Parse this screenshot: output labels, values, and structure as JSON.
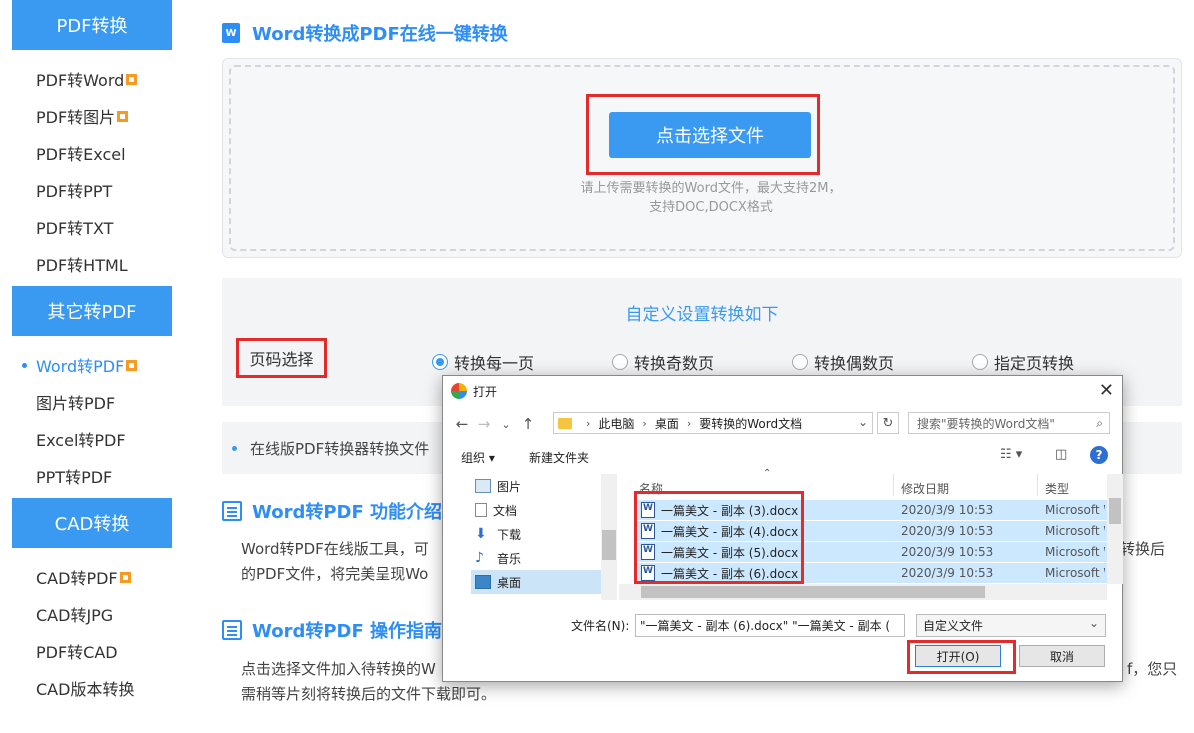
{
  "sidebar": {
    "sections": [
      {
        "title": "PDF转换",
        "items": [
          {
            "label": "PDF转Word",
            "badge": true
          },
          {
            "label": "PDF转图片",
            "badge": true
          },
          {
            "label": "PDF转Excel",
            "badge": false
          },
          {
            "label": "PDF转PPT",
            "badge": false
          },
          {
            "label": "PDF转TXT",
            "badge": false
          },
          {
            "label": "PDF转HTML",
            "badge": false
          }
        ]
      },
      {
        "title": "其它转PDF",
        "items": [
          {
            "label": "Word转PDF",
            "badge": true,
            "active": true
          },
          {
            "label": "图片转PDF",
            "badge": false
          },
          {
            "label": "Excel转PDF",
            "badge": false
          },
          {
            "label": "PPT转PDF",
            "badge": false
          }
        ]
      },
      {
        "title": "CAD转换",
        "items": [
          {
            "label": "CAD转PDF",
            "badge": true
          },
          {
            "label": "CAD转JPG",
            "badge": false
          },
          {
            "label": "PDF转CAD",
            "badge": false
          },
          {
            "label": "CAD版本转换",
            "badge": false
          }
        ]
      }
    ]
  },
  "main": {
    "title": "Word转换成PDF在线一键转换",
    "upload": {
      "button": "点击选择文件",
      "hint_line1": "请上传需要转换的Word文件，最大支持2M，",
      "hint_line2": "支持DOC,DOCX格式"
    },
    "settings": {
      "title": "自定义设置转换如下",
      "page_label": "页码选择",
      "options": [
        "转换每一页",
        "转换奇数页",
        "转换偶数页",
        "指定页转换"
      ],
      "selected": "转换每一页"
    },
    "note": "在线版PDF转换器转换文件",
    "intro": {
      "title": "Word转PDF 功能介绍：",
      "line1_left": "Word转PDF在线版工具，可",
      "line1_right": "转换后",
      "line2": "的PDF文件，将完美呈现Wo"
    },
    "guide": {
      "title": "Word转PDF 操作指南：",
      "line1_left": "点击选择文件加入待转换的W",
      "line1_right": "f，您只",
      "line2": "需稍等片刻将转换后的文件下载即可。"
    }
  },
  "dialog": {
    "title": "打开",
    "breadcrumb": [
      "此电脑",
      "桌面",
      "要转换的Word文档"
    ],
    "search_placeholder": "搜索\"要转换的Word文档\"",
    "toolbar": {
      "organize": "组织 ▾",
      "new_folder": "新建文件夹"
    },
    "tree": [
      "图片",
      "文档",
      "下载",
      "音乐",
      "桌面"
    ],
    "columns": {
      "name": "名称",
      "date": "修改日期",
      "type": "类型"
    },
    "files": [
      {
        "name": "一篇美文 - 副本 (3).docx",
        "date": "2020/3/9 10:53",
        "type": "Microsoft W"
      },
      {
        "name": "一篇美文 - 副本 (4).docx",
        "date": "2020/3/9 10:53",
        "type": "Microsoft W"
      },
      {
        "name": "一篇美文 - 副本 (5).docx",
        "date": "2020/3/9 10:53",
        "type": "Microsoft W"
      },
      {
        "name": "一篇美文 - 副本 (6).docx",
        "date": "2020/3/9 10:53",
        "type": "Microsoft W"
      }
    ],
    "filename_label": "文件名(N):",
    "filename_value": "\"一篇美文 - 副本 (6).docx\" \"一篇美文 - 副本 (",
    "filetype": "自定义文件",
    "open_button": "打开(O)",
    "cancel_button": "取消"
  }
}
